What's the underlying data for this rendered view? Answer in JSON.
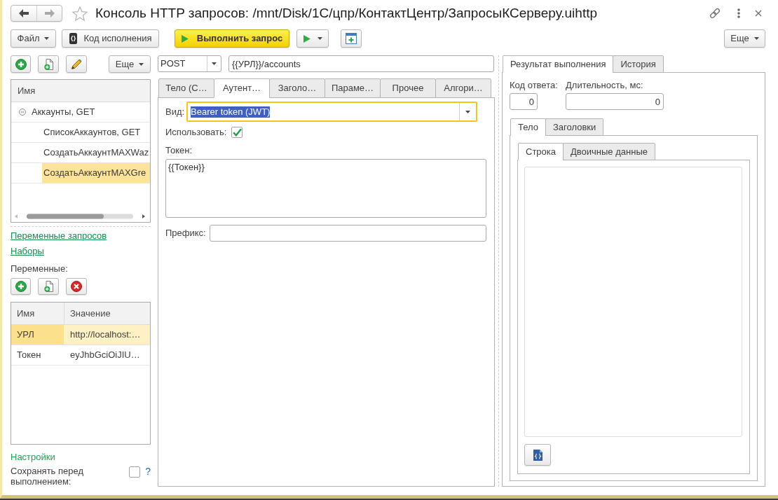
{
  "window": {
    "title": "Консоль HTTP запросов: /mnt/Disk/1C/цпр/КонтактЦентр/ЗапросыКСерверу.uihttp",
    "favorite": false,
    "nav_buttons": [
      {
        "kind": "back",
        "disabled": false
      },
      {
        "kind": "forward",
        "disabled": true
      }
    ]
  },
  "toolbar": {
    "file_menu": "Файл",
    "code_button": "Код исполнения",
    "run_button": "Выполнить запрос",
    "more": "Еще"
  },
  "requests": {
    "more": "Еще",
    "column": "Имя",
    "tree": [
      {
        "label": "Аккаунты, GET",
        "expanded": true,
        "selected": false,
        "children": [
          {
            "label": "СписокАккаунтов, GET",
            "selected": false
          },
          {
            "label": "СоздатьАккаунтMAXWaz",
            "selected": false
          },
          {
            "label": "СоздатьАккаунтMAXGre",
            "selected": true
          }
        ]
      }
    ]
  },
  "links": [
    "Переменные запросов",
    "Наборы"
  ],
  "variables": {
    "label": "Переменные:",
    "columns": [
      "Имя",
      "Значение"
    ],
    "rows": [
      {
        "name": "УРЛ",
        "value": "http://localhost:…",
        "selected": true
      },
      {
        "name": "Токен",
        "value": "eyJhbGciOiJIU…",
        "selected": false
      }
    ]
  },
  "settings": {
    "title": "Настройки",
    "save_before_run": {
      "label": "Сохранять перед выполнением:",
      "checked": false
    },
    "help": "?"
  },
  "request": {
    "method": "POST",
    "url": "{{УРЛ}}/accounts",
    "tabs": [
      {
        "label": "Тело (С…",
        "selected": false
      },
      {
        "label": "Аутент…",
        "selected": true
      },
      {
        "label": "Заголо…",
        "selected": false
      },
      {
        "label": "Параме…",
        "selected": false
      },
      {
        "label": "Прочее",
        "selected": false
      },
      {
        "label": "Алгори…",
        "selected": false
      }
    ],
    "auth": {
      "type_label": "Вид:",
      "type": "Bearer token (JWT)",
      "type_focused": true,
      "use_label": "Использовать:",
      "use": true,
      "token_label": "Токен:",
      "token": "{{Токен}}",
      "prefix_label": "Префикс:"
    }
  },
  "result": {
    "tabs": [
      {
        "label": "Результат выполнения",
        "selected": true
      },
      {
        "label": "История",
        "selected": false
      }
    ],
    "code_label": "Код ответа:",
    "code": "0",
    "duration_label": "Длительность, мс:",
    "duration": "0",
    "body_tabs": [
      {
        "label": "Тело",
        "selected": true
      },
      {
        "label": "Заголовки",
        "selected": false
      }
    ],
    "format_tabs": [
      {
        "label": "Строка",
        "selected": true
      },
      {
        "label": "Двоичные данные",
        "selected": false
      }
    ]
  }
}
